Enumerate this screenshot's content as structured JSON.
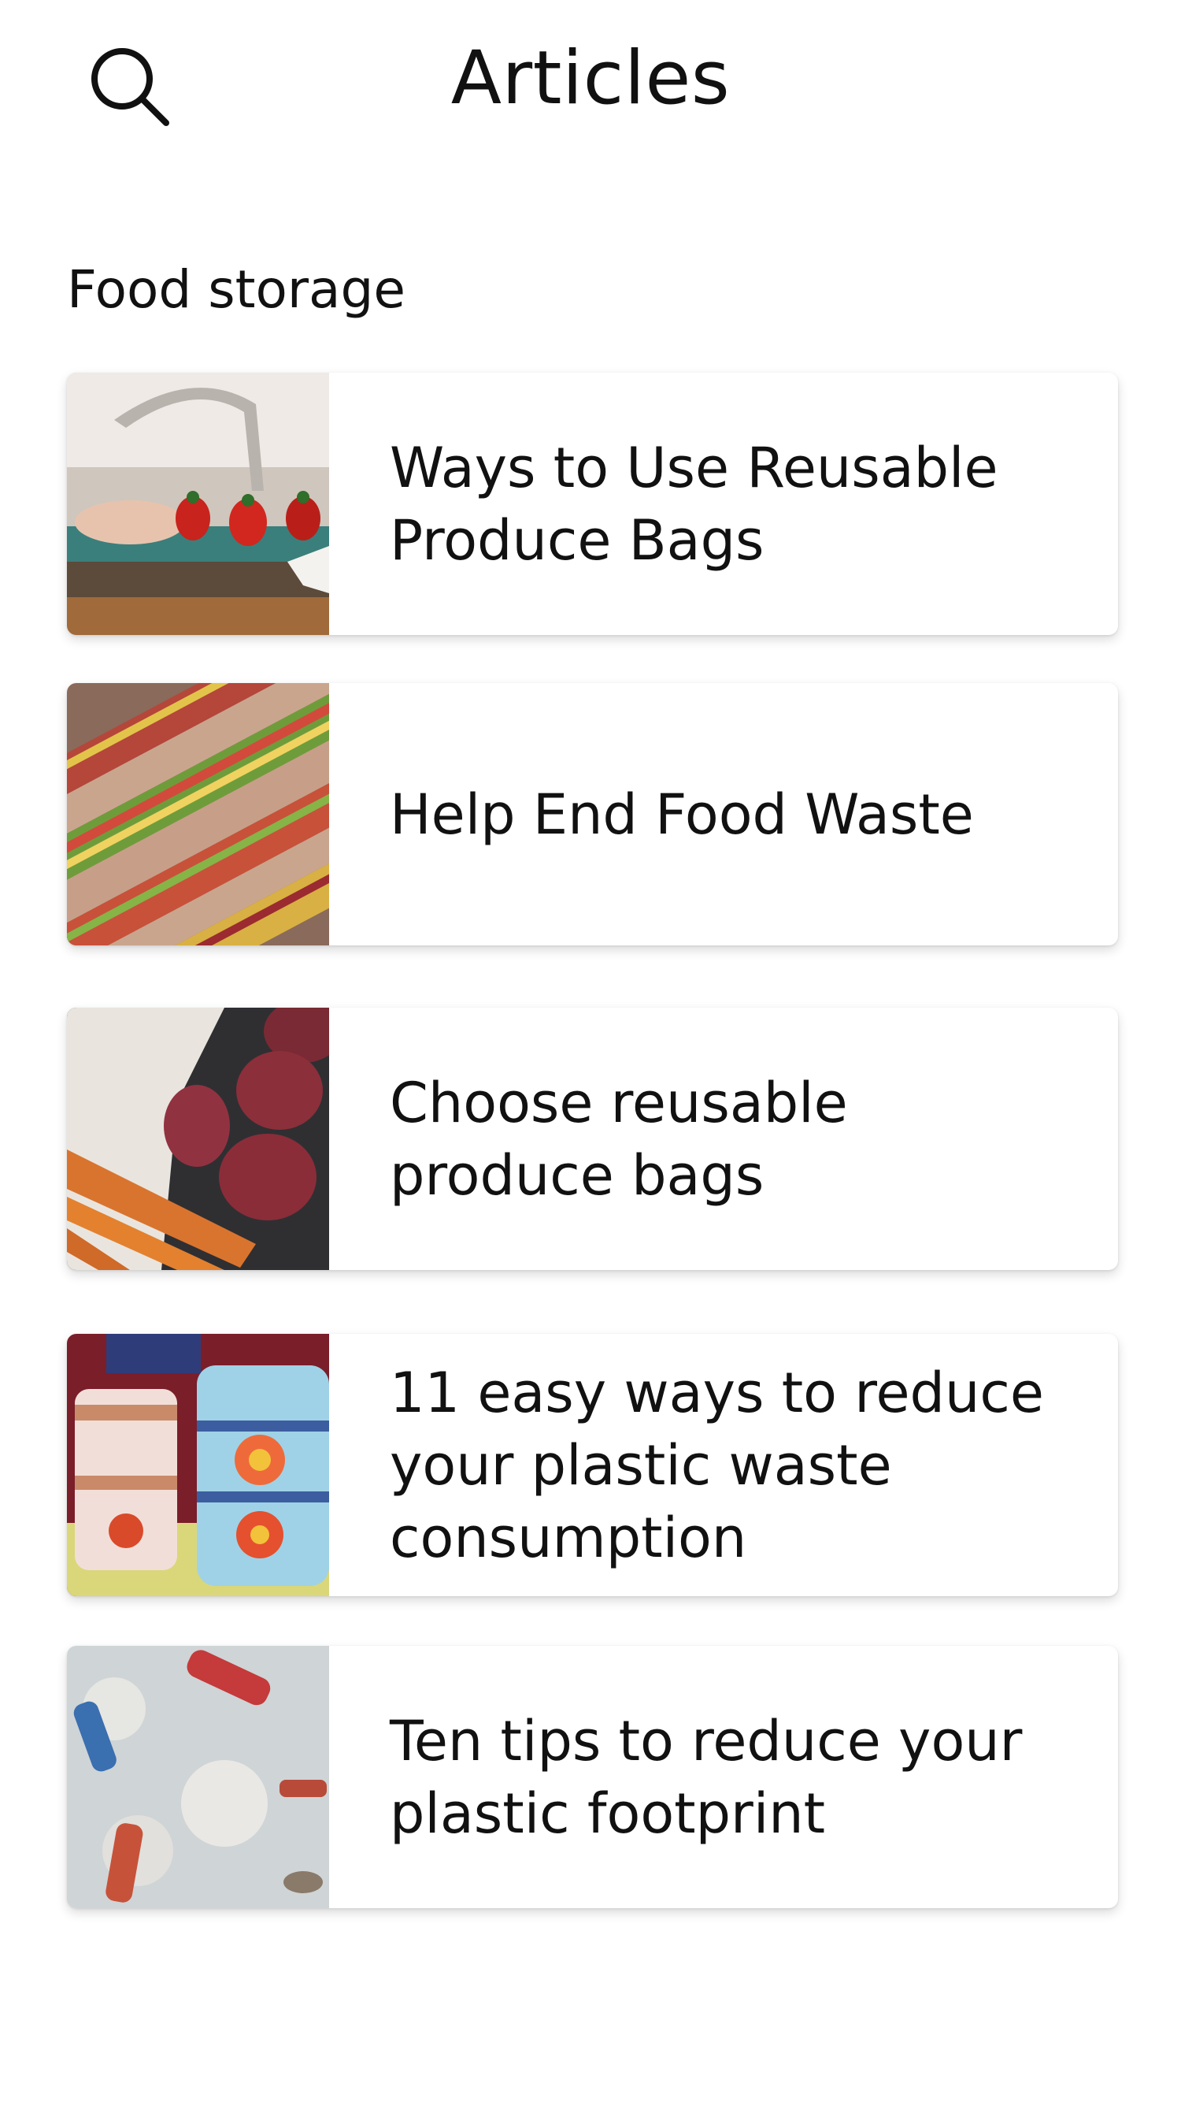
{
  "header": {
    "title": "Articles",
    "search_icon": "search-icon"
  },
  "section": {
    "label": "Food storage"
  },
  "articles": [
    {
      "title": "Ways to Use Reusable Produce Bags",
      "thumbnail": "strawberries-on-counter-image"
    },
    {
      "title": "Help End Food Waste",
      "thumbnail": "market-produce-stalls-image"
    },
    {
      "title": "Choose reusable produce bags",
      "thumbnail": "potatoes-and-carrots-bag-image"
    },
    {
      "title": "11 easy ways to reduce your plastic waste consumption",
      "thumbnail": "painted-tiffin-containers-image"
    },
    {
      "title": "Ten tips to reduce your plastic footprint",
      "thumbnail": "plastic-bottles-on-beach-image"
    }
  ],
  "colors": {
    "background": "#ffffff",
    "text": "#111111",
    "card": "#ffffff"
  }
}
